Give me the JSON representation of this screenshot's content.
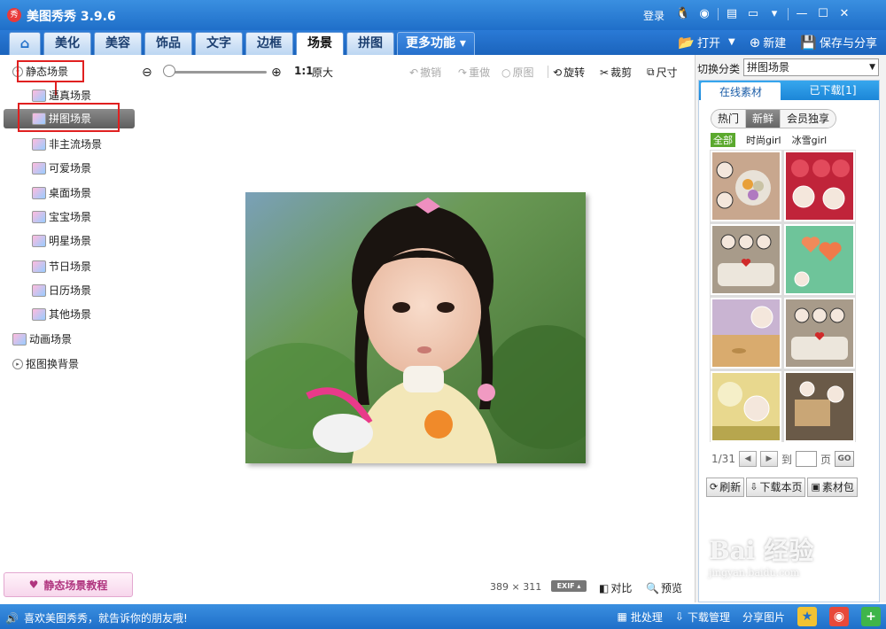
{
  "title_bar": {
    "app_name": "美图秀秀 3.9.6",
    "logo_text": "秀",
    "login": "登录",
    "icons": [
      "qq-icon",
      "weibo-icon",
      "news-icon",
      "message-icon",
      "dropdown-menu-icon",
      "minimize-icon",
      "maximize-icon",
      "close-icon"
    ]
  },
  "tabs": [
    {
      "label": "⌂",
      "name": "home"
    },
    {
      "label": "美化",
      "name": "beautify"
    },
    {
      "label": "美容",
      "name": "makeup"
    },
    {
      "label": "饰品",
      "name": "accessories"
    },
    {
      "label": "文字",
      "name": "text"
    },
    {
      "label": "边框",
      "name": "border"
    },
    {
      "label": "场景",
      "name": "scene"
    },
    {
      "label": "拼图",
      "name": "collage"
    },
    {
      "label": "更多功能 ▾",
      "name": "more"
    }
  ],
  "active_tab": "scene",
  "top_actions": {
    "open": "打开",
    "new": "新建",
    "save_share": "保存与分享"
  },
  "tree": {
    "static_scene": "静态场景",
    "children": [
      "逼真场景",
      "拼图场景",
      "非主流场景",
      "可爱场景",
      "桌面场景",
      "宝宝场景",
      "明星场景",
      "节日场景",
      "日历场景",
      "其他场景"
    ],
    "selected": "拼图场景",
    "animated_scene": "动画场景",
    "cutout_bg": "抠图换背景"
  },
  "tutorial_button": "静态场景教程",
  "toolbar": {
    "ratio": "1:1",
    "original_size": "原大",
    "undo": "撤销",
    "redo": "重做",
    "original": "原图",
    "rotate": "旋转",
    "crop": "裁剪",
    "resize": "尺寸",
    "zoom_level": 0.3
  },
  "image_info": {
    "width": "389",
    "times": "×",
    "height": "311",
    "exif": "EXIF ▴",
    "compare": "对比",
    "preview": "预览"
  },
  "right_panel": {
    "switch_label": "切换分类",
    "switch_value": "拼图场景",
    "tab_online": "在线素材",
    "tab_downloaded": "已下载[1]",
    "pills": [
      "热门",
      "新鲜",
      "会员独享"
    ],
    "active_pill": "新鲜",
    "categories": [
      "全部",
      "时尚girl",
      "冰雪girl"
    ],
    "active_category": "全部",
    "page_current": "1/31",
    "page_to": "到",
    "page_unit": "页",
    "go": "GO",
    "refresh": "刷新",
    "download_page": "下载本页",
    "material_pack": "素材包"
  },
  "watermark": {
    "logo": "Bai 经验",
    "url": "jingyan.baidu.com"
  },
  "status_bar": {
    "message": "喜欢美图秀秀，就告诉你的朋友哦!",
    "batch": "批处理",
    "download_mgr": "下载管理",
    "share_pic": "分享图片"
  },
  "colors": {
    "title_blue": "#1f6fc9",
    "highlight_red": "#e02020",
    "category_green": "#5ba92e"
  }
}
